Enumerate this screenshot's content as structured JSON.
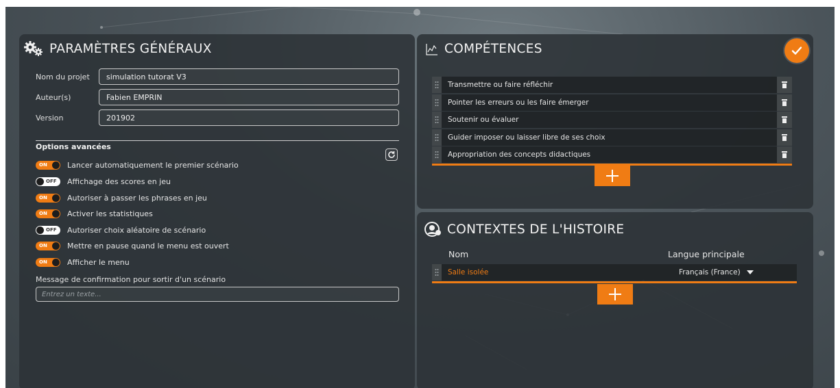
{
  "general": {
    "title": "PARAMÈTRES GÉNÉRAUX",
    "fields": [
      {
        "label": "Nom du projet",
        "value": "simulation tutorat V3"
      },
      {
        "label": "Auteur(s)",
        "value": "Fabien EMPRIN"
      },
      {
        "label": "Version",
        "value": "201902"
      }
    ],
    "advanced_title": "Options avancées",
    "options": [
      {
        "label": "Lancer automatiquement le premier scénario",
        "state": "ON"
      },
      {
        "label": "Affichage des scores en jeu",
        "state": "OFF"
      },
      {
        "label": "Autoriser à passer les phrases en jeu",
        "state": "ON"
      },
      {
        "label": "Activer les statistiques",
        "state": "ON"
      },
      {
        "label": "Autoriser choix aléatoire de scénario",
        "state": "OFF"
      },
      {
        "label": "Mettre en pause quand le menu est ouvert",
        "state": "ON"
      },
      {
        "label": "Afficher le menu",
        "state": "ON"
      }
    ],
    "exit_message_label": "Message de confirmation pour sortir d'un scénario",
    "exit_message_placeholder": "Entrez un texte..."
  },
  "competences": {
    "title": "COMPÉTENCES",
    "items": [
      "Transmettre ou faire réfléchir",
      "Pointer les erreurs ou les faire émerger",
      "Soutenir ou évaluer",
      "Guider imposer ou laisser libre de ses choix",
      "Appropriation des concepts didactiques"
    ]
  },
  "contexts": {
    "title": "CONTEXTES DE L'HISTOIRE",
    "col_name": "Nom",
    "col_lang": "Langue principale",
    "rows": [
      {
        "name": "Salle isolée",
        "language": "Français (France)"
      }
    ]
  },
  "colors": {
    "accent": "#f07c14",
    "panel": "#2c3237"
  },
  "icons": [
    "gears-icon",
    "chart-icon",
    "check-icon",
    "context-icon",
    "refresh-icon",
    "trash-icon",
    "grip-icon",
    "plus-icon",
    "dropdown-arrow-icon"
  ]
}
